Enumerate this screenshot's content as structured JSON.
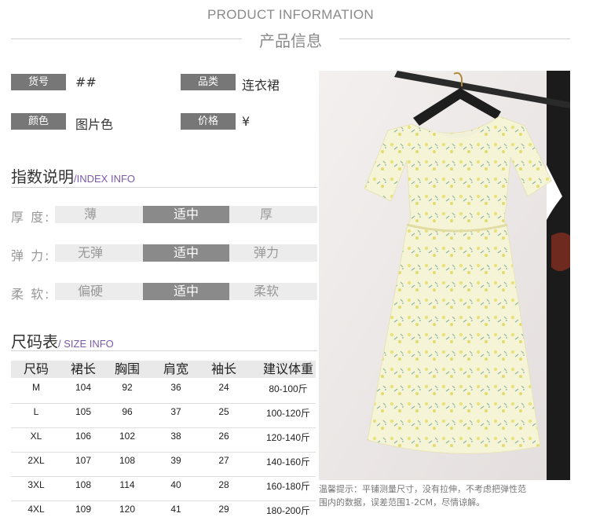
{
  "header": {
    "en": "PRODUCT INFORMATION",
    "cn": "产品信息"
  },
  "info": {
    "item_no": {
      "label": "货号",
      "value": "##"
    },
    "category": {
      "label": "品类",
      "value": "连衣裙"
    },
    "color": {
      "label": "颜色",
      "value": "图片色"
    },
    "price": {
      "label": "价格",
      "value": "¥"
    }
  },
  "index_info": {
    "title": "指数说明",
    "subtitle": "/INDEX INFO",
    "rows": [
      {
        "label": "厚 度:",
        "options": [
          "薄",
          "适中",
          "厚"
        ],
        "selected": "适中"
      },
      {
        "label": "弹 力:",
        "options": [
          "无弹",
          "适中",
          "弹力"
        ],
        "selected": "适中"
      },
      {
        "label": "柔 软:",
        "options": [
          "偏硬",
          "适中",
          "柔软"
        ],
        "selected": "适中"
      }
    ]
  },
  "size_info": {
    "title": "尺码表",
    "subtitle": "/ SIZE INFO",
    "headers": [
      "尺码",
      "裙长",
      "胸围",
      "肩宽",
      "袖长",
      "建议体重"
    ],
    "rows": [
      [
        "M",
        "104",
        "92",
        "36",
        "24",
        "80-100斤"
      ],
      [
        "L",
        "105",
        "96",
        "37",
        "25",
        "100-120斤"
      ],
      [
        "XL",
        "106",
        "102",
        "38",
        "26",
        "120-140斤"
      ],
      [
        "2XL",
        "107",
        "108",
        "39",
        "27",
        "140-160斤"
      ],
      [
        "3XL",
        "108",
        "114",
        "40",
        "28",
        "160-180斤"
      ],
      [
        "4XL",
        "109",
        "120",
        "41",
        "29",
        "180-200斤"
      ]
    ]
  },
  "photo": {
    "alt": ""
  },
  "note": {
    "line1": "温馨提示：平铺测量尺寸，没有拉伸，不考虑把弹性范",
    "line2": "围内的数据，误差范围1-2CM，尽情谅解。"
  }
}
